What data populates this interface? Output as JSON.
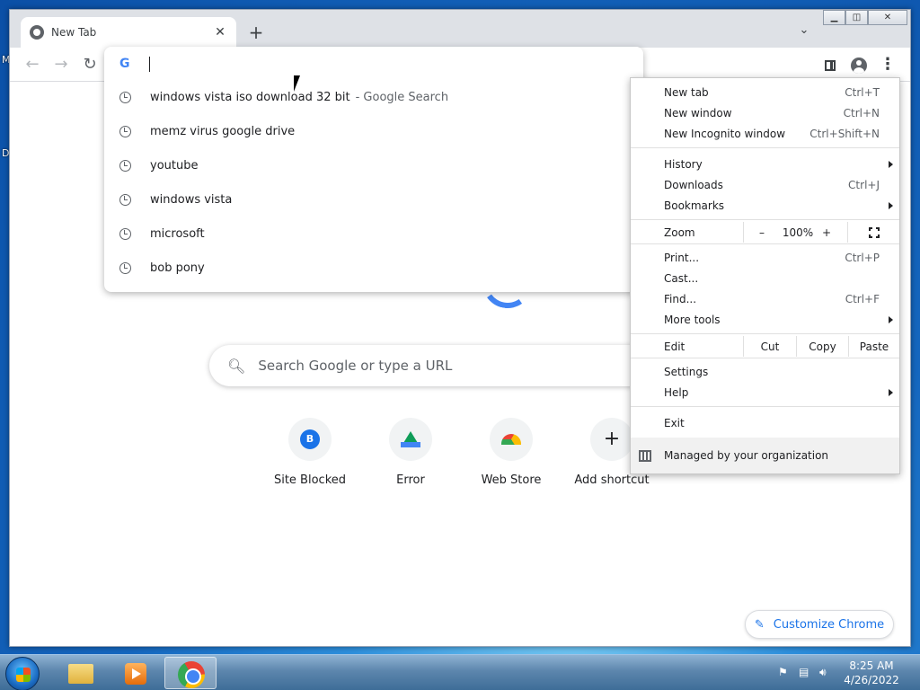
{
  "window": {
    "tab_title": "New Tab",
    "new_tab_symbol": "+",
    "tab_close_symbol": "✕",
    "tab_search_symbol": "⌄"
  },
  "desktop": {
    "edge_labels": [
      "M",
      "D"
    ]
  },
  "toolbar": {
    "back_symbol": "←",
    "forward_symbol": "→",
    "reload_symbol": "↻",
    "menu_symbol": "⋮"
  },
  "omnibox": {
    "value": "",
    "suggestions": [
      {
        "text": "windows vista iso download 32 bit",
        "suffix": "- Google Search"
      },
      {
        "text": "memz virus google drive",
        "suffix": ""
      },
      {
        "text": "youtube",
        "suffix": ""
      },
      {
        "text": "windows vista",
        "suffix": ""
      },
      {
        "text": "microsoft",
        "suffix": ""
      },
      {
        "text": "bob pony",
        "suffix": ""
      }
    ]
  },
  "ntp": {
    "search_placeholder": "Search Google or type a URL",
    "shortcuts": [
      {
        "label": "Site Blocked",
        "letter": "B"
      },
      {
        "label": "Error"
      },
      {
        "label": "Web Store"
      },
      {
        "label": "Add shortcut",
        "symbol": "+"
      }
    ],
    "customize_label": "Customize Chrome"
  },
  "menu": {
    "new_tab": {
      "label": "New tab",
      "shortcut": "Ctrl+T"
    },
    "new_window": {
      "label": "New window",
      "shortcut": "Ctrl+N"
    },
    "new_incognito": {
      "label": "New Incognito window",
      "shortcut": "Ctrl+Shift+N"
    },
    "history": {
      "label": "History"
    },
    "downloads": {
      "label": "Downloads",
      "shortcut": "Ctrl+J"
    },
    "bookmarks": {
      "label": "Bookmarks"
    },
    "zoom": {
      "label": "Zoom",
      "minus": "–",
      "value": "100%",
      "plus": "+"
    },
    "print": {
      "label": "Print...",
      "shortcut": "Ctrl+P"
    },
    "cast": {
      "label": "Cast..."
    },
    "find": {
      "label": "Find...",
      "shortcut": "Ctrl+F"
    },
    "more_tools": {
      "label": "More tools"
    },
    "edit": {
      "label": "Edit",
      "cut": "Cut",
      "copy": "Copy",
      "paste": "Paste"
    },
    "settings": {
      "label": "Settings"
    },
    "help": {
      "label": "Help"
    },
    "exit": {
      "label": "Exit"
    },
    "managed": {
      "label": "Managed by your organization"
    }
  },
  "taskbar": {
    "time": "8:25 AM",
    "date": "4/26/2022"
  }
}
